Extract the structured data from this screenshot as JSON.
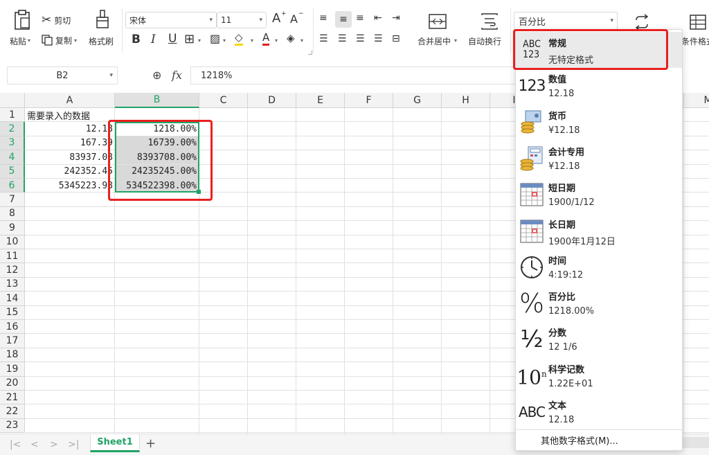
{
  "ribbon": {
    "paste_label": "粘贴",
    "cut_label": "剪切",
    "copy_label": "复制",
    "format_painter_label": "格式刷",
    "font_name": "宋体",
    "font_size": "11",
    "bold": "B",
    "italic": "I",
    "underline": "U",
    "merge_center_label": "合并居中",
    "wrap_text_label": "自动换行",
    "number_format_value": "百分比",
    "conditional_format_label": "条件格式",
    "grow_font": "A",
    "shrink_font": "A"
  },
  "formula_bar": {
    "cell_ref": "B2",
    "fx": "fx",
    "formula": "1218%"
  },
  "grid": {
    "columns": [
      "A",
      "B",
      "C",
      "D",
      "E",
      "F",
      "G",
      "H",
      "I",
      "",
      "",
      "",
      "M"
    ],
    "rows": [
      "1",
      "2",
      "3",
      "4",
      "5",
      "6",
      "7",
      "8",
      "9",
      "10",
      "11",
      "12",
      "13",
      "14",
      "15",
      "16",
      "17",
      "18",
      "19",
      "20",
      "21",
      "22",
      "23"
    ],
    "a1": "需要录入的数据",
    "col_a_values": [
      "12.18",
      "167.39",
      "83937.08",
      "242352.45",
      "5345223.98"
    ],
    "col_b_values": [
      "1218.00%",
      "16739.00%",
      "8393708.00%",
      "24235245.00%",
      "534522398.00%"
    ]
  },
  "sheet_tabs": {
    "active": "Sheet1",
    "add": "+"
  },
  "number_format_menu": {
    "items": [
      {
        "icon": "abc-123-icon",
        "title": "常规",
        "sample": "无特定格式"
      },
      {
        "icon": "123-icon",
        "title": "数值",
        "sample": "12.18"
      },
      {
        "icon": "coins-icon",
        "title": "货币",
        "sample": "¥12.18"
      },
      {
        "icon": "calculator-coins-icon",
        "title": "会计专用",
        "sample": "¥12.18"
      },
      {
        "icon": "calendar-icon",
        "title": "短日期",
        "sample": "1900/1/12"
      },
      {
        "icon": "calendar-icon",
        "title": "长日期",
        "sample": "1900年1月12日"
      },
      {
        "icon": "clock-icon",
        "title": "时间",
        "sample": "4:19:12"
      },
      {
        "icon": "percent-icon",
        "title": "百分比",
        "sample": "1218.00%"
      },
      {
        "icon": "fraction-icon",
        "title": "分数",
        "sample": "12 1/6"
      },
      {
        "icon": "scientific-icon",
        "title": "科学记数",
        "sample": "1.22E+01"
      },
      {
        "icon": "abc-icon",
        "title": "文本",
        "sample": "12.18"
      }
    ],
    "footer": "其他数字格式(M)..."
  },
  "colors": {
    "accent_green": "#21a366",
    "highlight_red": "#e8201f",
    "selection_gray": "#d9d9d9"
  }
}
